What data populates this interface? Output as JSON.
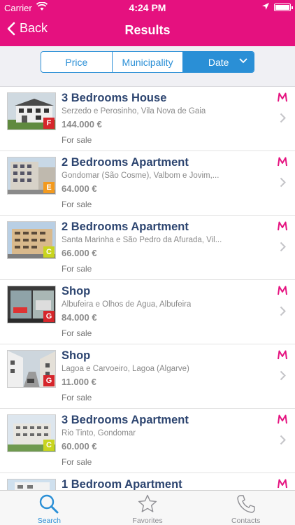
{
  "status_bar": {
    "carrier": "Carrier",
    "time": "4:24 PM"
  },
  "nav": {
    "back_label": "Back",
    "title": "Results"
  },
  "filters": {
    "price": "Price",
    "municipality": "Municipality",
    "date": "Date",
    "active": "date"
  },
  "colors": {
    "brand_pink": "#e5117f",
    "accent_blue": "#2a8fd6",
    "title_navy": "#2d4570"
  },
  "listings": [
    {
      "title": "3 Bedrooms House",
      "location": "Serzedo e Perosinho, Vila Nova de Gaia",
      "price": "144.000 €",
      "status": "For sale",
      "energy": "F",
      "energy_color": "#d6262b"
    },
    {
      "title": "2 Bedrooms Apartment",
      "location": "Gondomar (São Cosme), Valbom e Jovim,...",
      "price": "64.000 €",
      "status": "For sale",
      "energy": "E",
      "energy_color": "#f39a1e"
    },
    {
      "title": "2 Bedrooms Apartment",
      "location": "Santa Marinha e São Pedro da Afurada, Vil...",
      "price": "66.000 €",
      "status": "For sale",
      "energy": "C",
      "energy_color": "#c8d41f"
    },
    {
      "title": "Shop",
      "location": "Albufeira e Olhos de Água, Albufeira",
      "price": "84.000 €",
      "status": "For sale",
      "energy": "G",
      "energy_color": "#d6262b"
    },
    {
      "title": "Shop",
      "location": "Lagoa e Carvoeiro, Lagoa (Algarve)",
      "price": "11.000 €",
      "status": "For sale",
      "energy": "G",
      "energy_color": "#d6262b"
    },
    {
      "title": "3 Bedrooms Apartment",
      "location": "Rio Tinto, Gondomar",
      "price": "60.000 €",
      "status": "For sale",
      "energy": "C",
      "energy_color": "#c8d41f"
    },
    {
      "title": "1 Bedroom Apartment",
      "location": "",
      "price": "",
      "status": "",
      "energy": "",
      "energy_color": ""
    }
  ],
  "tabs": [
    {
      "label": "Search",
      "icon": "search-icon",
      "active": true
    },
    {
      "label": "Favorites",
      "icon": "star-icon",
      "active": false
    },
    {
      "label": "Contacts",
      "icon": "phone-icon",
      "active": false
    }
  ]
}
